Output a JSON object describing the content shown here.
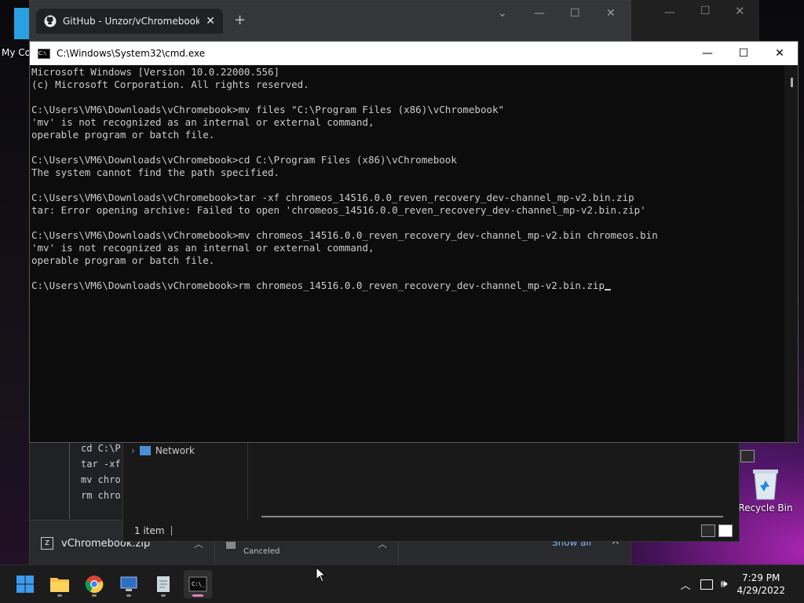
{
  "desktop": {
    "my_computer_label": "My Co",
    "recycle_bin_label": "Recycle Bin"
  },
  "browser": {
    "tab_title": "GitHub - Unzor/vChromebook: C",
    "code_lines": [
      "cd C:\\P",
      "tar -xf",
      "mv chro",
      "rm chro"
    ],
    "downloads": [
      {
        "name": "vChromebook.zip"
      },
      {
        "name": "",
        "status": "Canceled"
      }
    ],
    "show_all": "Show all"
  },
  "explorer": {
    "nav_item": "Network",
    "status_text": "1 item"
  },
  "cmd": {
    "title": "C:\\Windows\\System32\\cmd.exe",
    "lines": [
      "Microsoft Windows [Version 10.0.22000.556]",
      "(c) Microsoft Corporation. All rights reserved.",
      "",
      "C:\\Users\\VM6\\Downloads\\vChromebook>mv files \"C:\\Program Files (x86)\\vChromebook\"",
      "'mv' is not recognized as an internal or external command,",
      "operable program or batch file.",
      "",
      "C:\\Users\\VM6\\Downloads\\vChromebook>cd C:\\Program Files (x86)\\vChromebook",
      "The system cannot find the path specified.",
      "",
      "C:\\Users\\VM6\\Downloads\\vChromebook>tar -xf chromeos_14516.0.0_reven_recovery_dev-channel_mp-v2.bin.zip",
      "tar: Error opening archive: Failed to open 'chromeos_14516.0.0_reven_recovery_dev-channel_mp-v2.bin.zip'",
      "",
      "C:\\Users\\VM6\\Downloads\\vChromebook>mv chromeos_14516.0.0_reven_recovery_dev-channel_mp-v2.bin chromeos.bin",
      "'mv' is not recognized as an internal or external command,",
      "operable program or batch file.",
      ""
    ],
    "current_input": "C:\\Users\\VM6\\Downloads\\vChromebook>rm chromeos_14516.0.0_reven_recovery_dev-channel_mp-v2.bin.zip"
  },
  "taskbar": {
    "apps": [
      "start-icon",
      "file-explorer-icon",
      "chrome-icon",
      "remote-desktop-icon",
      "notepad-icon",
      "cmd-icon"
    ],
    "time": "7:29 PM",
    "date": "4/29/2022"
  },
  "colors": {
    "console_bg": "#0c0c0c",
    "console_text": "#cccccc",
    "accent": "#0078d4"
  }
}
